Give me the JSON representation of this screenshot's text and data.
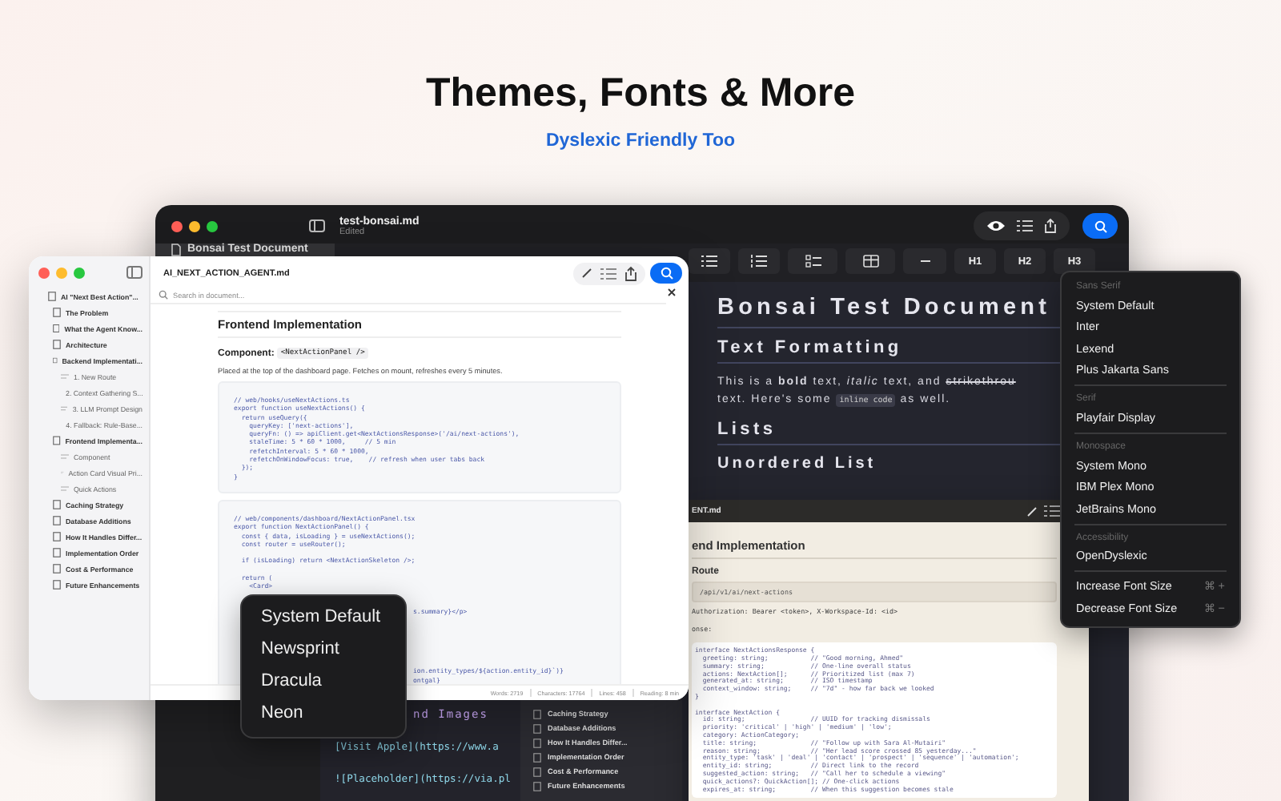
{
  "page": {
    "title": "Themes, Fonts & More",
    "subtitle": "Dyslexic Friendly Too"
  },
  "bonsai_window": {
    "title": "test-bonsai.md",
    "subtitle": "Edited",
    "sidebar_items": [
      {
        "label": "Bonsai Test Document",
        "selected": true
      }
    ],
    "toolbar": [
      {
        "kind": "bullets"
      },
      {
        "kind": "numbers"
      },
      {
        "kind": "checklist"
      },
      {
        "kind": "table"
      },
      {
        "kind": "rule"
      },
      {
        "kind": "heading",
        "label": "H1"
      },
      {
        "kind": "heading",
        "label": "H2"
      },
      {
        "kind": "heading",
        "label": "H3"
      }
    ],
    "document": [
      {
        "kind": "h1",
        "text": "Bonsai Test Document"
      },
      {
        "kind": "h2",
        "text": "Text Formatting"
      },
      {
        "kind": "p",
        "lines": [
          [
            {
              "kind": "text",
              "text": "This is a "
            },
            {
              "kind": "bold",
              "text": "bold"
            },
            {
              "kind": "text",
              "text": " text, "
            },
            {
              "kind": "italic",
              "text": "italic"
            },
            {
              "kind": "text",
              "text": " text, and "
            },
            {
              "kind": "strike",
              "text": "strikethrou"
            }
          ],
          [
            {
              "kind": "text",
              "text": "text. Here's some "
            },
            {
              "kind": "code",
              "text": "inline code"
            },
            {
              "kind": "text",
              "text": " as well."
            }
          ]
        ]
      },
      {
        "kind": "h2",
        "text": "Lists"
      },
      {
        "kind": "h3",
        "text": "Unordered List"
      }
    ]
  },
  "lower_dark_window": {
    "lines": [
      {
        "kind": "heading",
        "text": "nd Images"
      },
      {
        "kind": "link",
        "text": "[Visit Apple](https://www.a"
      },
      {
        "kind": "link",
        "text": "![Placeholder](https://via.pl"
      }
    ],
    "sidebar_items": [
      "Caching Strategy",
      "Database Additions",
      "How It Handles Differ...",
      "Implementation Order",
      "Cost & Performance",
      "Future Enhancements"
    ]
  },
  "newsprint_window": {
    "title": "ENT.md",
    "blocks": [
      {
        "kind": "h2",
        "text": "end Implementation"
      },
      {
        "kind": "h3",
        "text": "Route"
      },
      {
        "kind": "codebox",
        "lines": [
          {
            "kind": "line",
            "text": "/api/v1/ai/next-actions"
          }
        ]
      },
      {
        "kind": "p",
        "text": "Authorization: Bearer <token>, X-Workspace-Id: <id>"
      },
      {
        "kind": "p",
        "text": "onse:"
      },
      {
        "kind": "code",
        "lines": [
          {
            "kind": "line",
            "text": "interface NextActionsResponse {"
          },
          {
            "kind": "line",
            "text": "  greeting: string;           // \"Good morning, Ahmed\""
          },
          {
            "kind": "line",
            "text": "  summary: string;            // One-line overall status"
          },
          {
            "kind": "line",
            "text": "  actions: NextAction[];      // Prioritized list (max 7)"
          },
          {
            "kind": "line",
            "text": "  generated_at: string;       // ISO timestamp"
          },
          {
            "kind": "line",
            "text": "  context_window: string;     // \"7d\" - how far back we looked"
          },
          {
            "kind": "line",
            "text": "}"
          },
          {
            "kind": "blank"
          },
          {
            "kind": "line",
            "text": "interface NextAction {"
          },
          {
            "kind": "line",
            "text": "  id: string;                 // UUID for tracking dismissals"
          },
          {
            "kind": "line",
            "text": "  priority: 'critical' | 'high' | 'medium' | 'low';"
          },
          {
            "kind": "line",
            "text": "  category: ActionCategory;"
          },
          {
            "kind": "line",
            "text": "  title: string;              // \"Follow up with Sara Al-Mutairi\""
          },
          {
            "kind": "line",
            "text": "  reason: string;             // \"Her lead score crossed 85 yesterday...\""
          },
          {
            "kind": "line",
            "text": "  entity_type: 'task' | 'deal' | 'contact' | 'prospect' | 'sequence' | 'automation';"
          },
          {
            "kind": "line",
            "text": "  entity_id: string;          // Direct link to the record"
          },
          {
            "kind": "line",
            "text": "  suggested_action: string;   // \"Call her to schedule a viewing\""
          },
          {
            "kind": "line",
            "text": "  quick_actions?: QuickAction[]; // One-click actions"
          },
          {
            "kind": "line",
            "text": "  expires_at: string;         // When this suggestion becomes stale"
          }
        ]
      }
    ]
  },
  "light_window": {
    "title": "AI_NEXT_ACTION_AGENT.md",
    "search": {
      "placeholder": "Search in document..."
    },
    "outline": [
      {
        "label": "AI \"Next Best Action\"...",
        "children": [
          {
            "label": "The Problem"
          },
          {
            "label": "What the Agent Know..."
          },
          {
            "label": "Architecture"
          },
          {
            "label": "Backend Implementati...",
            "children": [
              {
                "label": "1. New Route"
              },
              {
                "label": "2. Context Gathering S..."
              },
              {
                "label": "3. LLM Prompt Design"
              },
              {
                "label": "4. Fallback: Rule-Base..."
              }
            ]
          },
          {
            "label": "Frontend Implementa...",
            "children": [
              {
                "label": "Component"
              },
              {
                "label": "Action Card Visual Pri..."
              },
              {
                "label": "Quick Actions"
              }
            ]
          },
          {
            "label": "Caching Strategy"
          },
          {
            "label": "Database Additions"
          },
          {
            "label": "How It Handles Differ..."
          },
          {
            "label": "Implementation Order"
          },
          {
            "label": "Cost & Performance"
          },
          {
            "label": "Future Enhancements"
          }
        ]
      }
    ],
    "document": [
      {
        "kind": "h2",
        "text": "Frontend Implementation"
      },
      {
        "kind": "h3",
        "text": "Component: ",
        "code": "<NextActionPanel />"
      },
      {
        "kind": "p",
        "text": "Placed at the top of the dashboard page. Fetches on mount, refreshes every 5 minutes."
      },
      {
        "kind": "code",
        "lines": [
          {
            "kind": "line",
            "text": "// web/hooks/useNextActions.ts"
          },
          {
            "kind": "line",
            "text": "export function useNextActions() {"
          },
          {
            "kind": "line",
            "text": "  return useQuery({"
          },
          {
            "kind": "line",
            "text": "    queryKey: ['next-actions'],"
          },
          {
            "kind": "line",
            "text": "    queryFn: () => apiClient.get<NextActionsResponse>('/ai/next-actions'),"
          },
          {
            "kind": "line",
            "text": "    staleTime: 5 * 60 * 1000,     // 5 min"
          },
          {
            "kind": "line",
            "text": "    refetchInterval: 5 * 60 * 1000,"
          },
          {
            "kind": "line",
            "text": "    refetchOnWindowFocus: true,    // refresh when user tabs back"
          },
          {
            "kind": "line",
            "text": "  });"
          },
          {
            "kind": "line",
            "text": "}"
          }
        ]
      },
      {
        "kind": "code",
        "lines": [
          {
            "kind": "line",
            "text": "// web/components/dashboard/NextActionPanel.tsx"
          },
          {
            "kind": "line",
            "text": "export function NextActionPanel() {"
          },
          {
            "kind": "line",
            "text": "  const { data, isLoading } = useNextActions();"
          },
          {
            "kind": "line",
            "text": "  const router = useRouter();"
          },
          {
            "kind": "blank"
          },
          {
            "kind": "line",
            "text": "  if (isLoading) return <NextActionSkeleton />;"
          },
          {
            "kind": "blank"
          },
          {
            "kind": "line",
            "text": "  return ("
          },
          {
            "kind": "line",
            "text": "    <Card>"
          },
          {
            "kind": "blank"
          },
          {
            "kind": "blank"
          },
          {
            "kind": "fragment",
            "text": "s.summary}</p>"
          },
          {
            "kind": "blank"
          },
          {
            "kind": "blank"
          },
          {
            "kind": "blank"
          },
          {
            "kind": "blank"
          },
          {
            "kind": "blank"
          },
          {
            "kind": "blank"
          },
          {
            "kind": "fragment",
            "text": "ion.entity_types/${action.entity_id}`)}"
          },
          {
            "kind": "fragment",
            "text": "ontgal}"
          }
        ]
      }
    ],
    "status": [
      "Words: 2719",
      "Characters: 17764",
      "Lines: 458",
      "Reading: 8 min"
    ]
  },
  "theme_menu": [
    {
      "label": "System Default"
    },
    {
      "label": "Newsprint"
    },
    {
      "label": "Dracula"
    },
    {
      "label": "Neon"
    }
  ],
  "font_menu": [
    {
      "kind": "header",
      "label": "Sans Serif"
    },
    {
      "kind": "item",
      "label": "System Default"
    },
    {
      "kind": "item",
      "label": "Inter"
    },
    {
      "kind": "item",
      "label": "Lexend"
    },
    {
      "kind": "item",
      "label": "Plus Jakarta Sans"
    },
    {
      "kind": "separator"
    },
    {
      "kind": "header",
      "label": "Serif"
    },
    {
      "kind": "item",
      "label": "Playfair Display"
    },
    {
      "kind": "separator"
    },
    {
      "kind": "header",
      "label": "Monospace"
    },
    {
      "kind": "item",
      "label": "System Mono"
    },
    {
      "kind": "item",
      "label": "IBM Plex Mono"
    },
    {
      "kind": "item",
      "label": "JetBrains Mono"
    },
    {
      "kind": "separator"
    },
    {
      "kind": "header",
      "label": "Accessibility"
    },
    {
      "kind": "item",
      "label": "OpenDyslexic"
    },
    {
      "kind": "separator"
    },
    {
      "kind": "item",
      "label": "Increase Font Size",
      "shortcut": "⌘ +"
    },
    {
      "kind": "item",
      "label": "Decrease Font Size",
      "shortcut": "⌘ −"
    }
  ]
}
